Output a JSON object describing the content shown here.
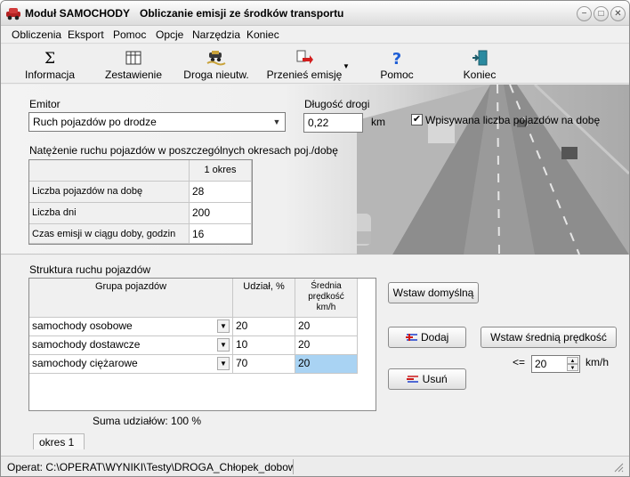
{
  "title": {
    "module": "Moduł SAMOCHODY",
    "subtitle": "Obliczanie emisji ze środków transportu"
  },
  "window_buttons": {
    "minimize": "−",
    "maximize": "□",
    "close": "✕"
  },
  "menu": [
    "Obliczenia",
    "Eksport",
    "Pomoc",
    "Opcje",
    "Narzędzia",
    "Koniec"
  ],
  "toolbar": [
    {
      "label": "Informacja",
      "icon": "sigma-icon"
    },
    {
      "label": "Zestawienie",
      "icon": "table-icon"
    },
    {
      "label": "Droga nieutw.",
      "icon": "dirt-road-icon"
    },
    {
      "label": "Przenieś emisję",
      "icon": "transfer-emission-icon"
    },
    {
      "label": "Pomoc",
      "icon": "help-icon"
    },
    {
      "label": "Koniec",
      "icon": "exit-door-icon"
    }
  ],
  "emitor": {
    "label": "Emitor",
    "value": "Ruch pojazdów po drodze"
  },
  "road_length": {
    "label": "Długość drogi",
    "value": "0,22",
    "unit": "km"
  },
  "entered_count": {
    "label": "Wpisywana liczba pojazdów na dobę",
    "checked": true
  },
  "intensity": {
    "title": "Natężenie ruchu pojazdów w poszczególnych okresach poj./dobę",
    "column": "1 okres",
    "rows": [
      {
        "label": "Liczba pojazdów na dobę",
        "value": "28"
      },
      {
        "label": "Liczba dni",
        "value": "200"
      },
      {
        "label": "Czas emisji w ciągu doby, godzin",
        "value": "16"
      }
    ]
  },
  "structure": {
    "title": "Struktura ruchu pojazdów",
    "headers": {
      "group": "Grupa pojazdów",
      "share": "Udział, %",
      "speed": "Średnia prędkość km/h"
    },
    "rows": [
      {
        "group": "samochody osobowe",
        "share": "20",
        "speed": "20"
      },
      {
        "group": "samochody dostawcze",
        "share": "10",
        "speed": "20"
      },
      {
        "group": "samochody ciężarowe",
        "share": "70",
        "speed": "20"
      }
    ],
    "sum_label": "Suma udziałów: 100 %"
  },
  "buttons": {
    "insert_default": "Wstaw domyślną",
    "add": "Dodaj",
    "remove": "Usuń",
    "insert_avg_speed": "Wstaw średnią prędkość"
  },
  "speed_limit": {
    "prefix": "<=",
    "value": "20",
    "unit": "km/h"
  },
  "tab": "okres  1",
  "status": "Operat: C:\\OPERAT\\WYNIKI\\Testy\\DROGA_Chłopek_dobowe",
  "colors": {
    "selected_cell": "#a9d3f3",
    "add_icon": "#cc1a1a",
    "remove_icon": "#1a3ccc"
  }
}
